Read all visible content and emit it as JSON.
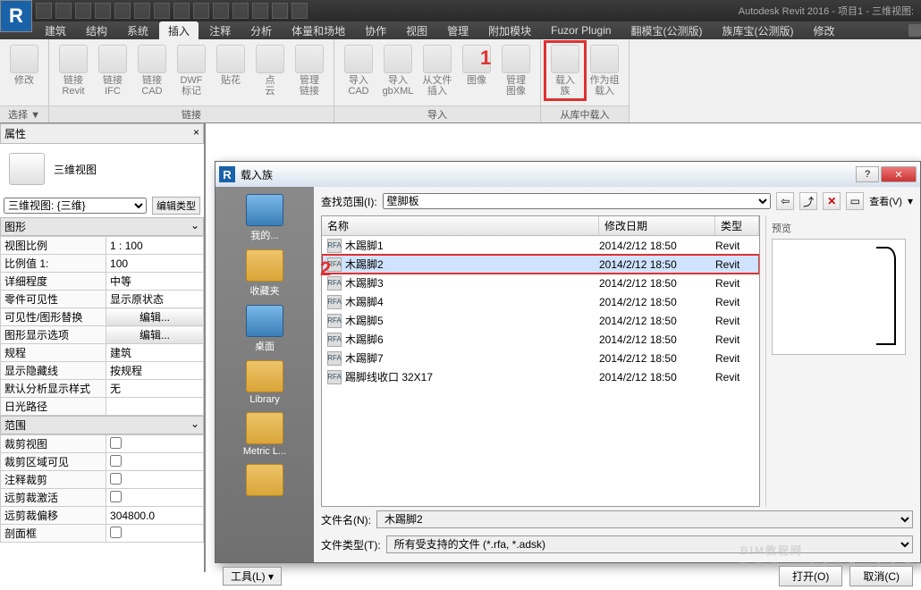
{
  "app": {
    "title": "Autodesk Revit 2016 -   项目1 - 三维视图:"
  },
  "tabs": [
    "建筑",
    "结构",
    "系统",
    "插入",
    "注释",
    "分析",
    "体量和场地",
    "协作",
    "视图",
    "管理",
    "附加模块",
    "Fuzor Plugin",
    "翻模宝(公测版)",
    "族库宝(公测版)",
    "修改"
  ],
  "active_tab": 3,
  "ribbon": {
    "p0": {
      "name": "选择 ▼",
      "items": [
        {
          "l1": "修改",
          "l2": ""
        }
      ]
    },
    "p1": {
      "name": "链接",
      "items": [
        {
          "l1": "链接",
          "l2": "Revit"
        },
        {
          "l1": "链接",
          "l2": "IFC"
        },
        {
          "l1": "链接",
          "l2": "CAD"
        },
        {
          "l1": "DWF",
          "l2": "标记"
        },
        {
          "l1": "贴花",
          "l2": " "
        },
        {
          "l1": "点",
          "l2": "云"
        },
        {
          "l1": "管理",
          "l2": "链接"
        }
      ]
    },
    "p2": {
      "name": "导入",
      "items": [
        {
          "l1": "导入",
          "l2": "CAD"
        },
        {
          "l1": "导入",
          "l2": "gbXML"
        },
        {
          "l1": "从文件",
          "l2": "插入"
        },
        {
          "l1": "图像",
          "l2": " "
        },
        {
          "l1": "管理",
          "l2": "图像"
        }
      ]
    },
    "p3": {
      "name": "从库中载入",
      "items": [
        {
          "l1": "载入",
          "l2": "族"
        },
        {
          "l1": "作为组",
          "l2": "载入"
        }
      ]
    }
  },
  "callouts": {
    "one": "1",
    "two": "2"
  },
  "props": {
    "panel": "属性",
    "type": "三维视图",
    "sel": "三维视图: {三维}",
    "edit": "编辑类型",
    "g_graphics": "图形",
    "rows_g": [
      [
        "视图比例",
        "1 : 100"
      ],
      [
        "比例值 1:",
        "100"
      ],
      [
        "详细程度",
        "中等"
      ],
      [
        "零件可见性",
        "显示原状态"
      ],
      [
        "可见性/图形替换",
        "_btn_编辑..."
      ],
      [
        "图形显示选项",
        "_btn_编辑..."
      ],
      [
        "规程",
        "建筑"
      ],
      [
        "显示隐藏线",
        "按规程"
      ],
      [
        "默认分析显示样式",
        "无"
      ],
      [
        "日光路径",
        ""
      ]
    ],
    "g_extent": "范围",
    "rows_e": [
      [
        "裁剪视图",
        "_chk"
      ],
      [
        "裁剪区域可见",
        "_chk"
      ],
      [
        "注释裁剪",
        "_chk"
      ],
      [
        "远剪裁激活",
        "_chk"
      ],
      [
        "远剪裁偏移",
        "304800.0"
      ],
      [
        "剖面框",
        "_chk"
      ]
    ]
  },
  "dlg": {
    "title": "载入族",
    "lookup_lbl": "查找范围(I):",
    "lookup_val": "壁脚板",
    "view_lbl": "查看(V)",
    "preview_lbl": "预览",
    "side": [
      {
        "n": "我的...",
        "c": "blue"
      },
      {
        "n": "收藏夹",
        "c": ""
      },
      {
        "n": "桌面",
        "c": "blue"
      },
      {
        "n": "Library",
        "c": ""
      },
      {
        "n": "Metric L...",
        "c": ""
      },
      {
        "n": "",
        "c": ""
      }
    ],
    "cols": {
      "c1": "名称",
      "c2": "修改日期",
      "c3": "类型"
    },
    "rows": [
      {
        "n": "木踢脚1",
        "d": "2014/2/12 18:50",
        "t": "Revit"
      },
      {
        "n": "木踢脚2",
        "d": "2014/2/12 18:50",
        "t": "Revit",
        "sel": true,
        "hl": true
      },
      {
        "n": "木踢脚3",
        "d": "2014/2/12 18:50",
        "t": "Revit"
      },
      {
        "n": "木踢脚4",
        "d": "2014/2/12 18:50",
        "t": "Revit"
      },
      {
        "n": "木踢脚5",
        "d": "2014/2/12 18:50",
        "t": "Revit"
      },
      {
        "n": "木踢脚6",
        "d": "2014/2/12 18:50",
        "t": "Revit"
      },
      {
        "n": "木踢脚7",
        "d": "2014/2/12 18:50",
        "t": "Revit"
      },
      {
        "n": "踢脚线收口 32X17",
        "d": "2014/2/12 18:50",
        "t": "Revit"
      }
    ],
    "fname_lbl": "文件名(N):",
    "fname": "木踢脚2",
    "ftype_lbl": "文件类型(T):",
    "ftype": "所有受支持的文件 (*.rfa, *.adsk)",
    "tools": "工具(L)",
    "open": "打开(O)",
    "cancel": "取消(C)"
  },
  "wm": {
    "main": "BIM教程网",
    "sub": "w w w . i f b i m . c o m"
  }
}
